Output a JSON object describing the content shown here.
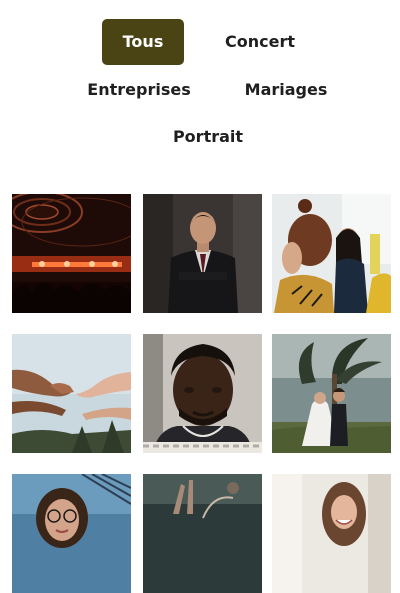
{
  "filters": {
    "items": [
      {
        "label": "Tous",
        "active": true
      },
      {
        "label": "Concert",
        "active": false
      },
      {
        "label": "Entreprises",
        "active": false
      },
      {
        "label": "Mariages",
        "active": false
      },
      {
        "label": "Portrait",
        "active": false
      }
    ],
    "active_color": "#4a4414"
  },
  "gallery": {
    "tiles": [
      {
        "subject": "concert-stage"
      },
      {
        "subject": "businessman-portrait"
      },
      {
        "subject": "office-meeting"
      },
      {
        "subject": "reaching-hands"
      },
      {
        "subject": "man-portrait"
      },
      {
        "subject": "wedding-couple"
      },
      {
        "subject": "woman-glasses"
      },
      {
        "subject": "crowd-hands"
      },
      {
        "subject": "bride-smiling"
      }
    ]
  }
}
